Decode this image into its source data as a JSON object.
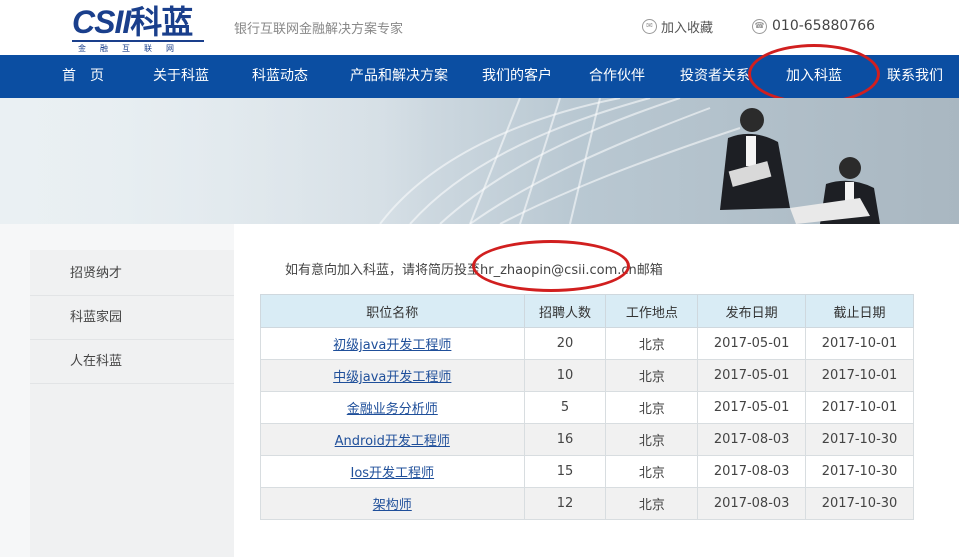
{
  "header": {
    "logo_main": "CSII",
    "logo_cn": "科蓝",
    "logo_sub": "金融互联网",
    "slogan": "银行互联网金融解决方案专家",
    "favorite_label": "加入收藏",
    "phone": "010-65880766"
  },
  "nav": {
    "items": [
      {
        "label": "首　页"
      },
      {
        "label": "关于科蓝"
      },
      {
        "label": "科蓝动态"
      },
      {
        "label": "产品和解决方案"
      },
      {
        "label": "我们的客户"
      },
      {
        "label": "合作伙伴"
      },
      {
        "label": "投资者关系"
      },
      {
        "label": "加入科蓝"
      },
      {
        "label": "联系我们"
      }
    ]
  },
  "sidebar": {
    "items": [
      {
        "label": "招贤纳才"
      },
      {
        "label": "科蓝家园"
      },
      {
        "label": "人在科蓝"
      }
    ]
  },
  "notice": {
    "prefix": "如有意向加入科蓝，请将简历投至",
    "email": "hr_zhaopin@csii.com.cn",
    "suffix": "邮箱"
  },
  "jobs_table": {
    "headers": [
      "职位名称",
      "招聘人数",
      "工作地点",
      "发布日期",
      "截止日期"
    ],
    "rows": [
      {
        "title": "初级java开发工程师",
        "count": "20",
        "location": "北京",
        "publish": "2017-05-01",
        "deadline": "2017-10-01"
      },
      {
        "title": "中级java开发工程师",
        "count": "10",
        "location": "北京",
        "publish": "2017-05-01",
        "deadline": "2017-10-01"
      },
      {
        "title": "金融业务分析师",
        "count": "5",
        "location": "北京",
        "publish": "2017-05-01",
        "deadline": "2017-10-01"
      },
      {
        "title": "Android开发工程师",
        "count": "16",
        "location": "北京",
        "publish": "2017-08-03",
        "deadline": "2017-10-30"
      },
      {
        "title": "Ios开发工程师",
        "count": "15",
        "location": "北京",
        "publish": "2017-08-03",
        "deadline": "2017-10-30"
      },
      {
        "title": "架构师",
        "count": "12",
        "location": "北京",
        "publish": "2017-08-03",
        "deadline": "2017-10-30"
      }
    ]
  },
  "colors": {
    "nav_bg": "#0b4ea2",
    "logo": "#1a3f8c",
    "annotation": "#d11f1f",
    "table_header_bg": "#d9ecf5",
    "link": "#1f4f9a"
  },
  "icons": {
    "favorite": "favorite-icon",
    "phone": "phone-icon"
  }
}
